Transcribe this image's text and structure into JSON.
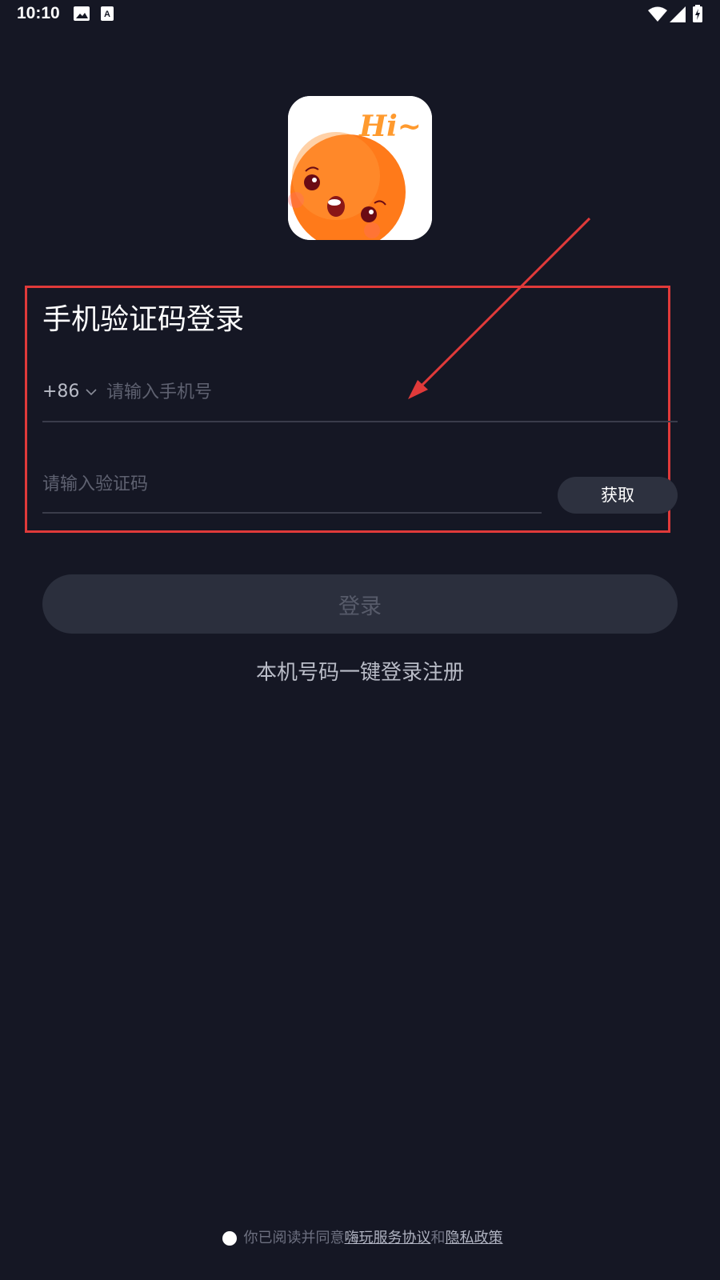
{
  "status_bar": {
    "time": "10:10",
    "icons": [
      "image-icon",
      "a-icon",
      "wifi-icon",
      "signal-icon",
      "battery-icon"
    ]
  },
  "logo": {
    "text": "Hi~",
    "icon": "orange-mascot-logo"
  },
  "login_form": {
    "title": "手机验证码登录",
    "country_code": "+86",
    "phone_placeholder": "请输入手机号",
    "code_placeholder": "请输入验证码",
    "get_code_label": "获取"
  },
  "login_button_label": "登录",
  "one_click_login_label": "本机号码一键登录注册",
  "agreement": {
    "prefix": "你已阅读并同意",
    "service_link": "嗨玩服务协议",
    "connector": "和",
    "privacy_link": "隐私政策"
  },
  "colors": {
    "background": "#151724",
    "annotation": "#e03a3a",
    "button_bg": "#2b2f3d",
    "logo_orange": "#ff7a1a"
  }
}
